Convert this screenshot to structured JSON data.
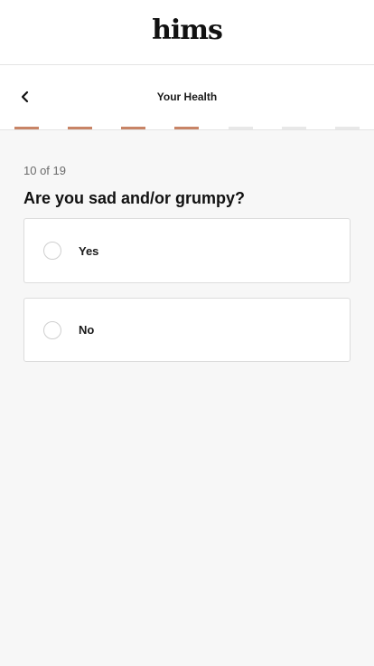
{
  "brand": {
    "logo_text": "hims"
  },
  "nav": {
    "title": "Your Health",
    "back_icon": "chevron-left-icon"
  },
  "progress": {
    "total_segments": 7,
    "completed_segments": 4,
    "completed_color": "#c88466",
    "remaining_color": "#e8e8e8"
  },
  "question": {
    "step_counter": "10 of 19",
    "text": "Are you sad and/or grumpy?"
  },
  "options": [
    {
      "label": "Yes",
      "selected": false
    },
    {
      "label": "No",
      "selected": false
    }
  ]
}
